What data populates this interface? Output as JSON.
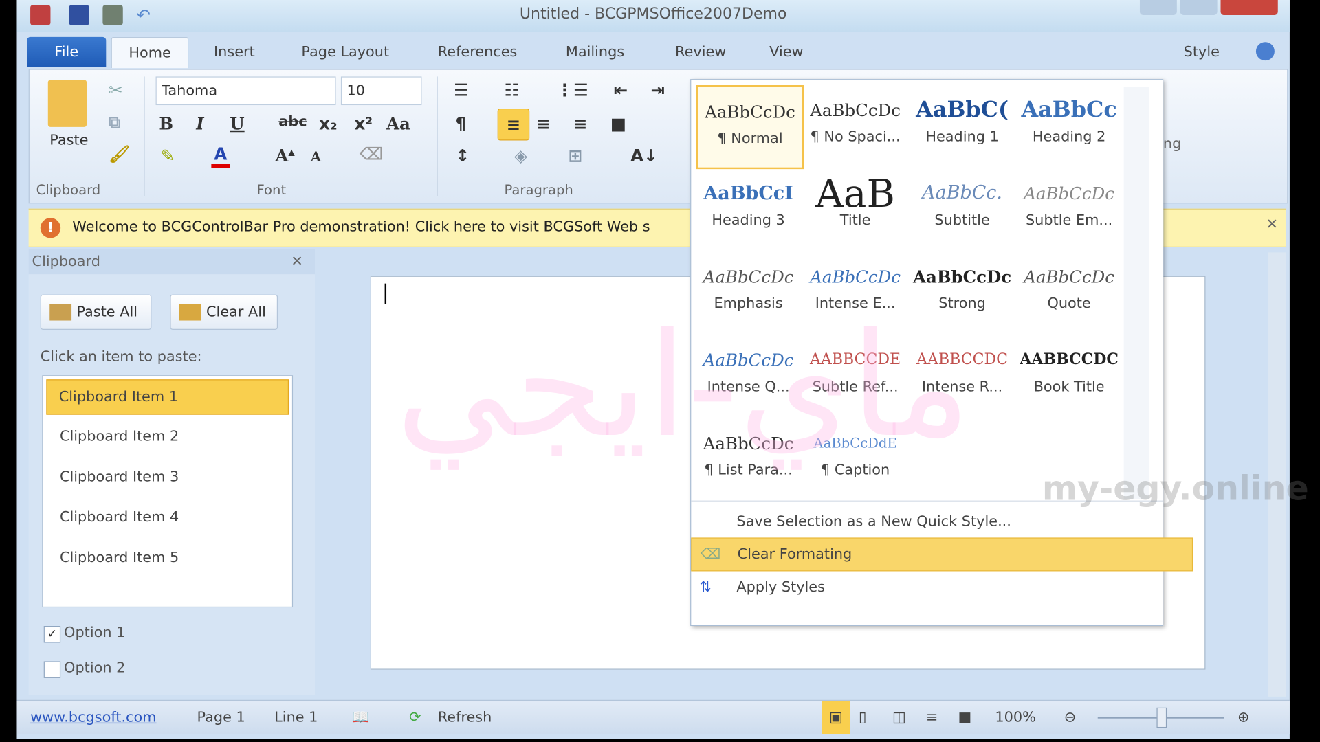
{
  "window": {
    "title": "Untitled - BCGPMSOffice2007Demo"
  },
  "tabs": [
    "File",
    "Home",
    "Insert",
    "Page Layout",
    "References",
    "Mailings",
    "Review",
    "View"
  ],
  "style_menu": "Style",
  "ribbon": {
    "clipboard": {
      "paste": "Paste",
      "label": "Clipboard"
    },
    "font": {
      "name": "Tahoma",
      "size": "10",
      "label": "Font"
    },
    "paragraph": {
      "label": "Paragraph"
    },
    "partial_label": "ing"
  },
  "infobar": {
    "text": "Welcome to BCGControlBar Pro demonstration! Click here to visit BCGSoft Web s"
  },
  "clipboard_pane": {
    "title": "Clipboard",
    "paste_all": "Paste All",
    "clear_all": "Clear All",
    "hint": "Click an item to paste:",
    "items": [
      "Clipboard Item 1",
      "Clipboard Item 2",
      "Clipboard Item 3",
      "Clipboard Item 4",
      "Clipboard Item 5"
    ],
    "options": [
      {
        "label": "Option 1",
        "checked": true
      },
      {
        "label": "Option 2",
        "checked": false
      }
    ]
  },
  "styles": [
    {
      "preview": "AaBbCcDc",
      "name": "¶ Normal"
    },
    {
      "preview": "AaBbCcDc",
      "name": "¶ No Spaci..."
    },
    {
      "preview": "AaBbC(",
      "name": "Heading 1"
    },
    {
      "preview": "AaBbCc",
      "name": "Heading 2"
    },
    {
      "preview": "AaBbCcI",
      "name": "Heading 3"
    },
    {
      "preview": "AaB",
      "name": "Title"
    },
    {
      "preview": "AaBbCc.",
      "name": "Subtitle"
    },
    {
      "preview": "AaBbCcDc",
      "name": "Subtle Em..."
    },
    {
      "preview": "AaBbCcDc",
      "name": "Emphasis"
    },
    {
      "preview": "AaBbCcDc",
      "name": "Intense E..."
    },
    {
      "preview": "AaBbCcDc",
      "name": "Strong"
    },
    {
      "preview": "AaBbCcDc",
      "name": "Quote"
    },
    {
      "preview": "AaBbCcDc",
      "name": "Intense Q..."
    },
    {
      "preview": "AABBCCDE",
      "name": "Subtle Ref..."
    },
    {
      "preview": "AABBCCDC",
      "name": "Intense R..."
    },
    {
      "preview": "AABBCCDC",
      "name": "Book Title"
    },
    {
      "preview": "AaBbCcDc",
      "name": "¶ List Para..."
    },
    {
      "preview": "AaBbCcDdE",
      "name": "¶ Caption"
    }
  ],
  "style_commands": [
    "Save Selection as a New Quick Style...",
    "Clear Formating",
    "Apply Styles"
  ],
  "statusbar": {
    "link": "www.bcgsoft.com",
    "page": "Page 1",
    "line": "Line 1",
    "refresh": "Refresh",
    "zoom": "100%",
    "zoom_level": 50
  },
  "watermark": {
    "arabic": "ماي-ايجي",
    "latin": "my-egy.online"
  },
  "colors": {
    "accent": "#f9cf4e",
    "file_tab": "#2a68c4",
    "infobar": "#fdf3b0"
  }
}
